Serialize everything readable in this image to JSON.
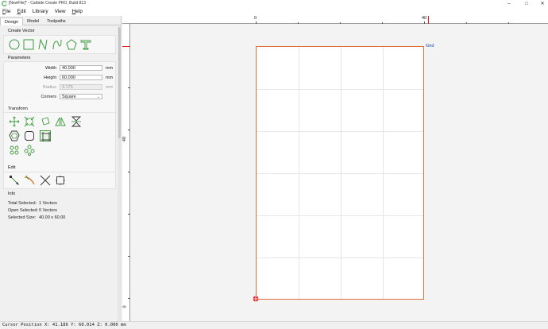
{
  "window": {
    "title": "[NewFile]* - Carbide Create PRO, Build 813",
    "controls": [
      "–",
      "□",
      "✕"
    ]
  },
  "menu": [
    {
      "label": "File",
      "accel": "F",
      "rest": "ile"
    },
    {
      "label": "Edit",
      "accel": "E",
      "rest": "dit"
    },
    {
      "label": "Library",
      "accel": "",
      "rest": "Library"
    },
    {
      "label": "View",
      "accel": "",
      "rest": "View"
    },
    {
      "label": "Help",
      "accel": "H",
      "rest": "elp"
    }
  ],
  "tabs": [
    "Design",
    "Model",
    "Toolpaths"
  ],
  "sections": {
    "create_vector": "Create Vector",
    "parameters": "Parameters",
    "transform": "Transform",
    "edit": "Edit",
    "info": "Info"
  },
  "parameters": {
    "width": {
      "label": "Width",
      "value": "40.000",
      "unit": "mm"
    },
    "height": {
      "label": "Height",
      "value": "60.000",
      "unit": "mm"
    },
    "radius": {
      "label": "Radius",
      "value": "3.175",
      "unit": "mm"
    },
    "corners": {
      "label": "Corners",
      "value": "Square"
    }
  },
  "info": {
    "total_selected_label": "Total Selected:",
    "total_selected_value": "1 Vectors",
    "open_selected_label": "Open Selected:",
    "open_selected_value": "0 Vectors",
    "selected_size_label": "Selected Size:",
    "selected_size_value": "40.00 x 60.00"
  },
  "rulers": {
    "top_labels": [
      "0",
      "40"
    ],
    "left_labels": [
      "40",
      "0"
    ]
  },
  "canvas": {
    "grid_label": "Grid",
    "stock_color": "#e06c3a",
    "grid_color": "#1a3fb0"
  },
  "status": {
    "text": "Cursor Position X: 41.186 Y: 60.014 Z: 0.000 mm"
  },
  "colors": {
    "tool_green": "#3d9a3d",
    "accent_red": "#e02020"
  }
}
